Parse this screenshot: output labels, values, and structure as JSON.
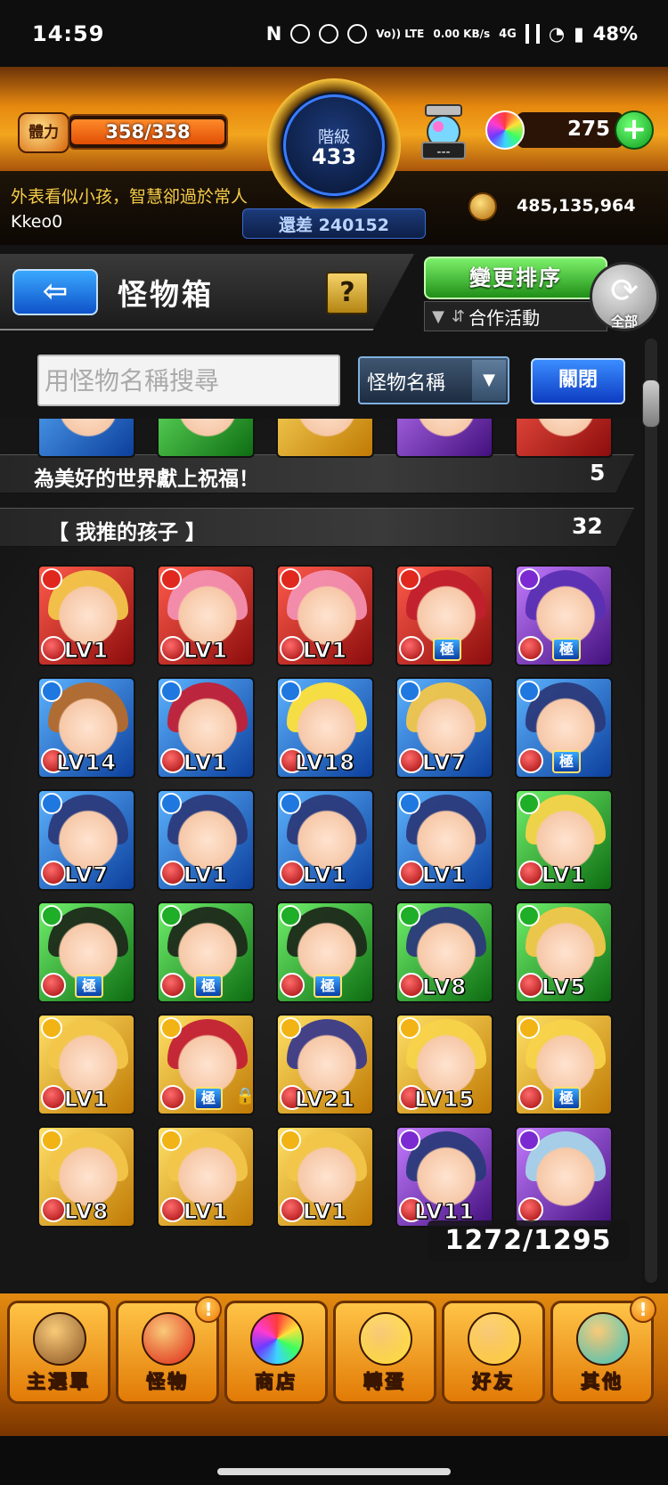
{
  "status_bar": {
    "time": "14:59",
    "network": "Vo)) LTE",
    "speed": "0.00 KB/s",
    "cell": "4G",
    "battery": "48%"
  },
  "header": {
    "stamina_label": "體力",
    "stamina_value": "358/358",
    "rank_label": "階級",
    "rank_value": "433",
    "rank_diff": "還差 240152",
    "lamp_label": "---",
    "gem_count": "275",
    "gem_add_label": "+",
    "player_motto": "外表看似小孩，智慧卻過於常人",
    "player_name": "Kkeo0",
    "coin_count": "485,135,964"
  },
  "titlebar": {
    "back_label": "⇦",
    "title": "怪物箱",
    "help_label": "?",
    "sort_button": "變更排序",
    "sort_current": "合作活動",
    "all_label": "全部"
  },
  "search": {
    "placeholder": "用怪物名稱搜尋",
    "type_label": "怪物名稱",
    "close_label": "關閉"
  },
  "sections": [
    {
      "title": "為美好的世界獻上祝福！",
      "count": "5"
    },
    {
      "title": "【 我推的孩子 】",
      "count": "32"
    }
  ],
  "top_partial_row": [
    {
      "attr": "water",
      "hair": "#3a2a40"
    },
    {
      "attr": "wood",
      "hair": "#e6c55a"
    },
    {
      "attr": "light",
      "hair": "#f0d77a"
    },
    {
      "attr": "dark",
      "hair": "#8a5a3a"
    },
    {
      "attr": "fire",
      "hair": "#8a5a3a"
    }
  ],
  "monsters": [
    {
      "attr": "fire",
      "hair": "#f2c64a",
      "label": "LV1",
      "type": "lv"
    },
    {
      "attr": "fire",
      "hair": "#f38fb0",
      "label": "LV1",
      "type": "lv"
    },
    {
      "attr": "fire",
      "hair": "#f38fb0",
      "label": "LV1",
      "type": "lv"
    },
    {
      "attr": "fire",
      "hair": "#c0202c",
      "label": "極",
      "type": "ult"
    },
    {
      "attr": "dark",
      "hair": "#5a2fb2",
      "label": "極",
      "type": "ult"
    },
    {
      "attr": "water",
      "hair": "#b56a2a",
      "label": "LV14",
      "type": "lv"
    },
    {
      "attr": "water",
      "hair": "#c22035",
      "label": "LV1",
      "type": "lv"
    },
    {
      "attr": "water",
      "hair": "#ffe23a",
      "label": "LV18",
      "type": "lv"
    },
    {
      "attr": "water",
      "hair": "#f2c64a",
      "label": "LV7",
      "type": "lv"
    },
    {
      "attr": "water",
      "hair": "#2b3a7a",
      "label": "極",
      "type": "ult"
    },
    {
      "attr": "water",
      "hair": "#2b3a7a",
      "label": "LV7",
      "type": "lv"
    },
    {
      "attr": "water",
      "hair": "#2b3a7a",
      "label": "LV1",
      "type": "lv"
    },
    {
      "attr": "water",
      "hair": "#2b3a7a",
      "label": "LV1",
      "type": "lv"
    },
    {
      "attr": "water",
      "hair": "#2b3a7a",
      "label": "LV1",
      "type": "lv"
    },
    {
      "attr": "wood",
      "hair": "#f7d34a",
      "label": "LV1",
      "type": "lv"
    },
    {
      "attr": "wood",
      "hair": "#1e2a1a",
      "label": "極",
      "type": "ult"
    },
    {
      "attr": "wood",
      "hair": "#1e2a1a",
      "label": "極",
      "type": "ult"
    },
    {
      "attr": "wood",
      "hair": "#1e2a1a",
      "label": "極",
      "type": "ult"
    },
    {
      "attr": "wood",
      "hair": "#2b3a7a",
      "label": "LV8",
      "type": "lv"
    },
    {
      "attr": "wood",
      "hair": "#f2c64a",
      "label": "LV5",
      "type": "lv"
    },
    {
      "attr": "light",
      "hair": "#f2c64a",
      "label": "LV1",
      "type": "lv"
    },
    {
      "attr": "light",
      "hair": "#c22035",
      "label": "極",
      "type": "ult",
      "locked": true
    },
    {
      "attr": "light",
      "hair": "#3a3a8a",
      "label": "LV21",
      "type": "lv"
    },
    {
      "attr": "light",
      "hair": "#f7d34a",
      "label": "LV15",
      "type": "lv"
    },
    {
      "attr": "light",
      "hair": "#f7d34a",
      "label": "極",
      "type": "ult"
    },
    {
      "attr": "light",
      "hair": "#f2c64a",
      "label": "LV8",
      "type": "lv"
    },
    {
      "attr": "light",
      "hair": "#f2c64a",
      "label": "LV1",
      "type": "lv"
    },
    {
      "attr": "light",
      "hair": "#f2c64a",
      "label": "LV1",
      "type": "lv"
    },
    {
      "attr": "dark",
      "hair": "#2b3a7a",
      "label": "LV11",
      "type": "lv"
    },
    {
      "attr": "dark",
      "hair": "#a7d4e8",
      "label": "",
      "type": "lv"
    }
  ],
  "box_counter": "1272/1295",
  "bottom_nav": [
    {
      "label": "主選單",
      "icon": "castle-icon",
      "color": "#8a5a2a",
      "alert": false
    },
    {
      "label": "怪物",
      "icon": "monster-icon",
      "color": "#e02a1a",
      "alert": true
    },
    {
      "label": "商店",
      "icon": "orb-icon",
      "color": "rainbow",
      "alert": false
    },
    {
      "label": "轉蛋",
      "icon": "egg-icon",
      "color": "#ffe23a",
      "alert": false
    },
    {
      "label": "好友",
      "icon": "friends-icon",
      "color": "#ffd23a",
      "alert": false
    },
    {
      "label": "其他",
      "icon": "other-icon",
      "color": "#3ac8c0",
      "alert": true
    }
  ],
  "nav_alert_mark": "!",
  "colors": {
    "fire": "#e0281e",
    "water": "#1e78e0",
    "wood": "#1fae27",
    "light": "#f2b414",
    "dark": "#7a2ad0"
  }
}
